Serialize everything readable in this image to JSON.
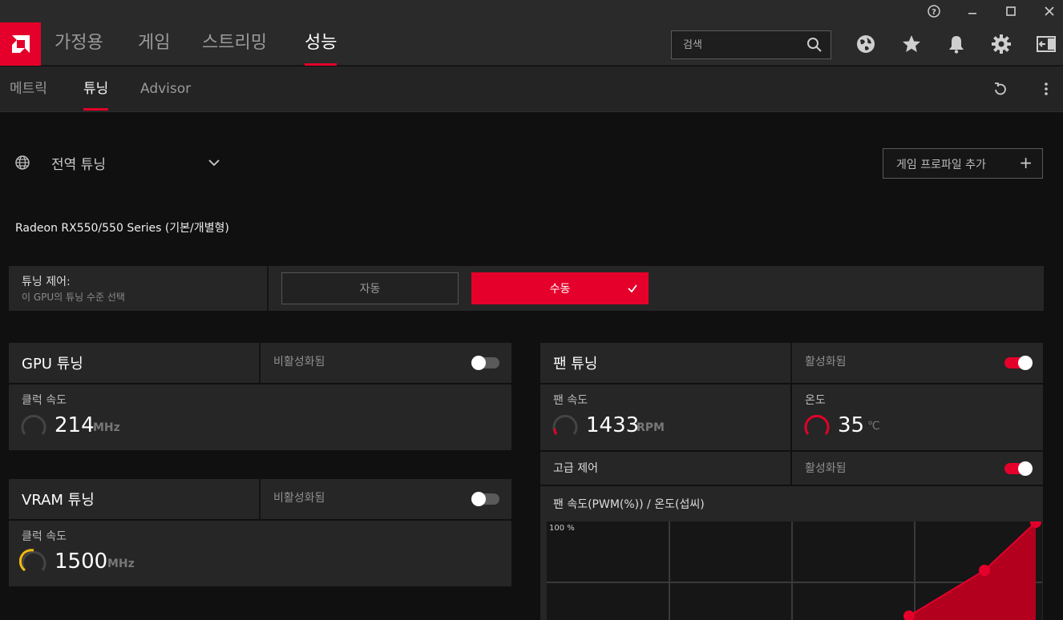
{
  "window": {
    "help_glyph": "?",
    "minimize_glyph": "—",
    "maximize_glyph": "☐",
    "close_glyph": "✕"
  },
  "nav": {
    "tabs": [
      {
        "label": "가정용"
      },
      {
        "label": "게임"
      },
      {
        "label": "스트리밍"
      },
      {
        "label": "성능",
        "active": true
      }
    ],
    "search_placeholder": "검색",
    "icons": [
      "globe-icon",
      "star-icon",
      "bell-icon",
      "gear-icon",
      "sidebar-icon"
    ]
  },
  "subnav": {
    "tabs": [
      {
        "label": "메트릭"
      },
      {
        "label": "튜닝",
        "active": true
      },
      {
        "label": "Advisor"
      }
    ]
  },
  "profile": {
    "label": "전역 튜닝",
    "add_profile_label": "게임 프로파일 추가",
    "add_glyph": "+"
  },
  "gpu_name": "Radeon RX550/550 Series (기본/개별형)",
  "tuning_control": {
    "title": "튜닝 제어:",
    "subtitle": "이 GPU의 튜닝 수준 선택",
    "auto_label": "자동",
    "manual_label": "수동",
    "selected": "manual"
  },
  "gpu_tuning": {
    "title": "GPU 튜닝",
    "state": "비활성화됨",
    "enabled": false,
    "clock_label": "클럭 속도",
    "clock_value": "214",
    "clock_unit": "MHz"
  },
  "vram_tuning": {
    "title": "VRAM 튜닝",
    "state": "비활성화됨",
    "enabled": false,
    "clock_label": "클럭 속도",
    "clock_value": "1500",
    "clock_unit": "MHz"
  },
  "fan_tuning": {
    "title": "팬 튜닝",
    "state": "활성화됨",
    "enabled": true,
    "fan_speed_label": "팬 속도",
    "fan_speed_value": "1433",
    "fan_speed_unit": "RPM",
    "temp_label": "온도",
    "temp_value": "35",
    "temp_unit": "℃",
    "advanced_label": "고급 제어",
    "advanced_state": "활성화됨",
    "advanced_enabled": true,
    "curve_title": "팬 속도(PWM(%)) / 온도(섭씨)",
    "curve_y_top_label": "100 %"
  },
  "colors": {
    "accent": "#e4002b",
    "gauge_yellow": "#f2b90f",
    "gauge_idle": "#444444"
  }
}
